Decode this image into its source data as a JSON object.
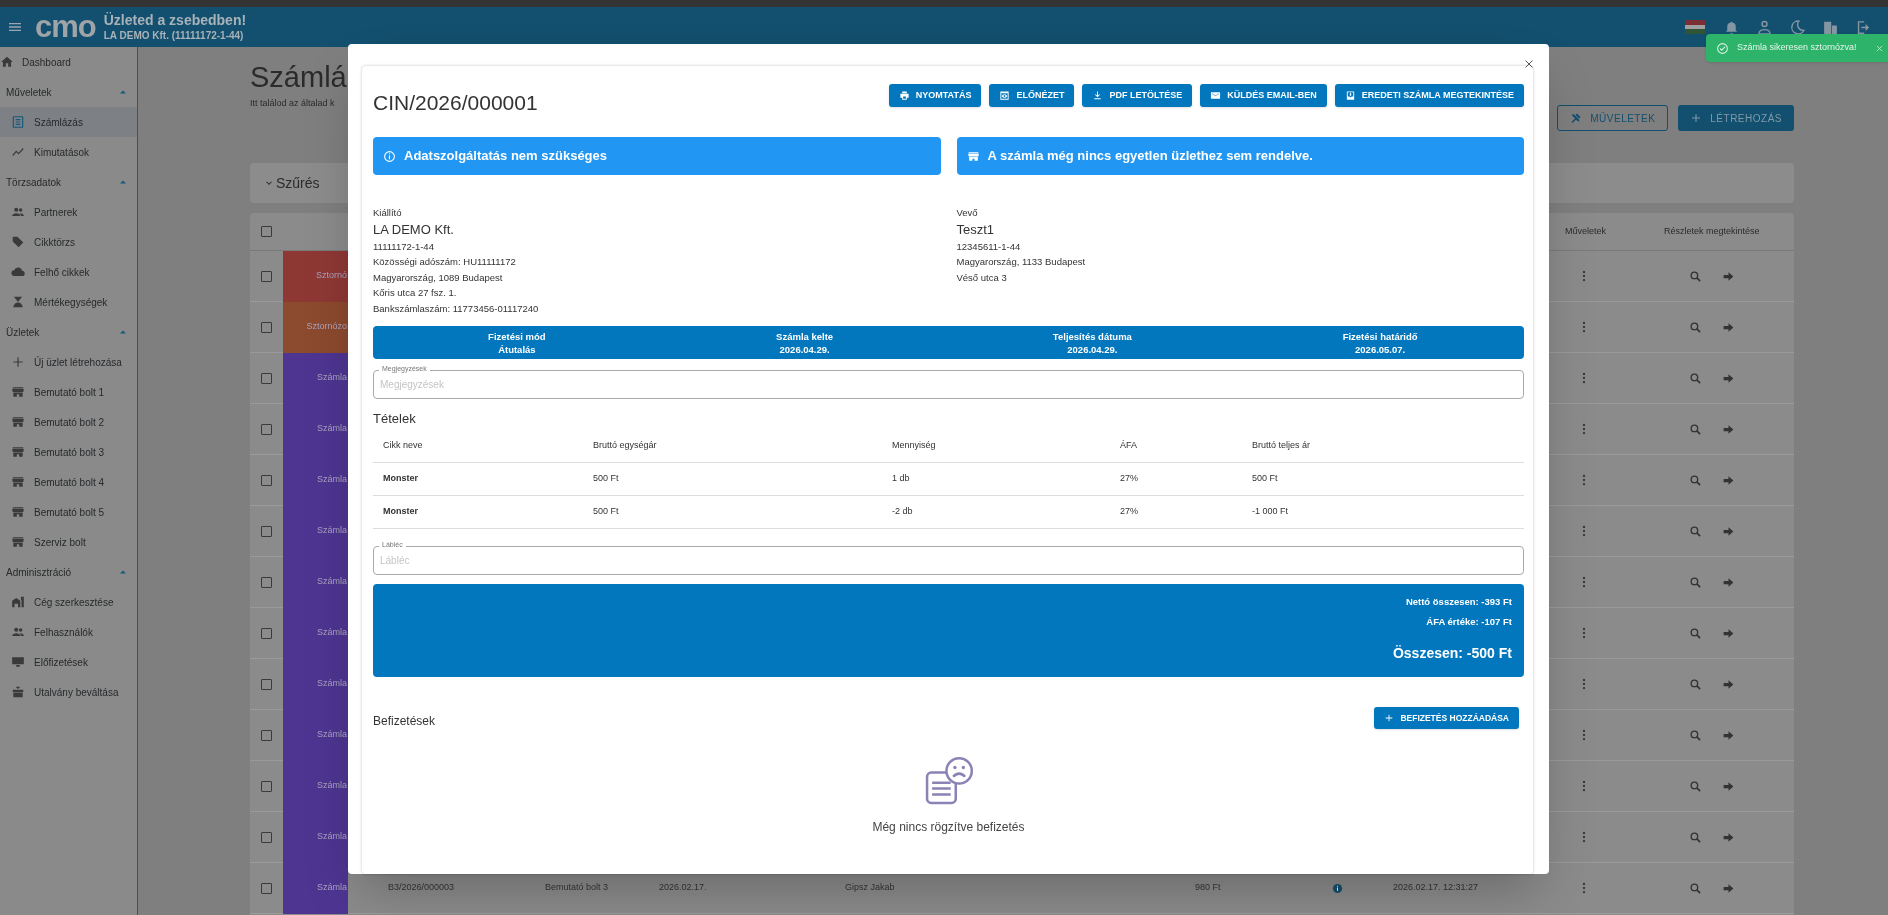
{
  "header": {
    "logo": "cmo",
    "title": "Üzleted a zsebedben!",
    "subtitle": "LA DEMO Kft. (11111172-1-44)"
  },
  "toast": {
    "message": "Számla sikeresen sztornózva!"
  },
  "sidebar": {
    "items": [
      {
        "kind": "link",
        "label": "Dashboard",
        "selected": false
      },
      {
        "kind": "section",
        "label": "Műveletek",
        "expanded": true
      },
      {
        "kind": "item",
        "label": "Számlázás",
        "selected": true
      },
      {
        "kind": "item",
        "label": "Kimutatások",
        "selected": false
      },
      {
        "kind": "section",
        "label": "Törzsadatok",
        "expanded": true
      },
      {
        "kind": "item",
        "label": "Partnerek",
        "selected": false
      },
      {
        "kind": "item",
        "label": "Cikktörzs",
        "selected": false
      },
      {
        "kind": "item",
        "label": "Felhő cikkek",
        "selected": false
      },
      {
        "kind": "item",
        "label": "Mértékegységek",
        "selected": false
      },
      {
        "kind": "section",
        "label": "Üzletek",
        "expanded": true
      },
      {
        "kind": "item",
        "label": "Új üzlet létrehozása",
        "selected": false
      },
      {
        "kind": "item",
        "label": "Bemutató bolt 1",
        "selected": false
      },
      {
        "kind": "item",
        "label": "Bemutató bolt 2",
        "selected": false
      },
      {
        "kind": "item",
        "label": "Bemutató bolt 3",
        "selected": false
      },
      {
        "kind": "item",
        "label": "Bemutató bolt 4",
        "selected": false
      },
      {
        "kind": "item",
        "label": "Bemutató bolt 5",
        "selected": false
      },
      {
        "kind": "item",
        "label": "Szerviz bolt",
        "selected": false
      },
      {
        "kind": "section",
        "label": "Adminisztráció",
        "expanded": true
      },
      {
        "kind": "item",
        "label": "Cég szerkesztése",
        "selected": false
      },
      {
        "kind": "item",
        "label": "Felhasználók",
        "selected": false
      },
      {
        "kind": "item",
        "label": "Előfizetések",
        "selected": false
      },
      {
        "kind": "item",
        "label": "Utalvány beváltása",
        "selected": false
      }
    ]
  },
  "page": {
    "title": "Számlá",
    "subtitle": "Itt találod az általad k",
    "buttons": [
      "MŰVELETEK",
      "LÉTREHOZÁS"
    ],
    "filter": "Szűrés"
  },
  "table": {
    "select_all_checked": false,
    "columns": [
      "Műveletek",
      "Részletek megtekintése"
    ],
    "rows": [
      {
        "status": "Sztornó",
        "color": "#8e3834",
        "checked": false
      },
      {
        "status": "Sztornózo",
        "color": "#8c4a2e",
        "checked": false
      },
      {
        "status": "Számla",
        "color": "#4e3592",
        "checked": false
      },
      {
        "status": "Számla",
        "color": "#4e3592",
        "checked": false
      },
      {
        "status": "Számla",
        "color": "#4e3592",
        "checked": false
      },
      {
        "status": "Számla",
        "color": "#4e3592",
        "checked": false
      },
      {
        "status": "Számla",
        "color": "#4e3592",
        "checked": false
      },
      {
        "status": "Számla",
        "color": "#4e3592",
        "checked": false
      },
      {
        "status": "Számla",
        "color": "#4e3592",
        "checked": false
      },
      {
        "status": "Számla",
        "color": "#4e3592",
        "checked": false
      },
      {
        "status": "Számla",
        "color": "#4e3592",
        "checked": false
      },
      {
        "status": "Számla",
        "color": "#4e3592",
        "checked": false
      },
      {
        "status": "Számla",
        "color": "#4e3592",
        "checked": false,
        "cells": [
          "B3/2026/000003",
          "Bemutató bolt 3",
          "2026.02.17.",
          "Gipsz Jakab",
          "980 Ft",
          "2026.02.17. 12:31:27"
        ]
      }
    ]
  },
  "modal": {
    "title": "CIN/2026/000001",
    "actions": [
      "NYOMTATÁS",
      "ELŐNÉZET",
      "PDF LETÖLTÉSE",
      "KÜLDÉS EMAIL-BEN",
      "EREDETI SZÁMLA MEGTEKINTÉSE"
    ],
    "banners": [
      "Adatszolgáltatás nem szükséges",
      "A számla még nincs egyetlen üzlethez sem rendelve."
    ],
    "issuer": {
      "heading": "Kiállító",
      "name": "LA DEMO Kft.",
      "lines": [
        "11111172-1-44",
        "Közösségi adószám: HU11111172",
        "Magyarország, 1089 Budapest",
        "Kőris utca 27 fsz. 1.",
        "Bankszámlaszám: 11773456-01117240"
      ]
    },
    "buyer": {
      "heading": "Vevő",
      "name": "Teszt1",
      "lines": [
        "12345611-1-44",
        "Magyarország, 1133 Budapest",
        "Véső utca 3"
      ]
    },
    "info_bar": [
      {
        "label": "Fizetési mód",
        "value": "Átutalás"
      },
      {
        "label": "Számla kelte",
        "value": "2026.04.29."
      },
      {
        "label": "Teljesítés dátuma",
        "value": "2026.04.29."
      },
      {
        "label": "Fizetési határidő",
        "value": "2026.05.07."
      }
    ],
    "notes": {
      "label": "Megjegyzések",
      "placeholder": "Megjegyzések"
    },
    "items": {
      "title": "Tételek",
      "columns": [
        "Cikk neve",
        "Bruttó egységár",
        "Mennyiség",
        "ÁFA",
        "Bruttó teljes ár"
      ],
      "rows": [
        [
          "Monster",
          "500 Ft",
          "1 db",
          "27%",
          "500 Ft"
        ],
        [
          "Monster",
          "500 Ft",
          "-2 db",
          "27%",
          "-1 000 Ft"
        ]
      ]
    },
    "footer": {
      "label": "Lábléc",
      "placeholder": "Lábléc"
    },
    "totals": {
      "net": "Nettó összesen: -393 Ft",
      "vat": "ÁFA értéke: -107 Ft",
      "total": "Összesen: -500 Ft"
    },
    "payments": {
      "title": "Befizetések",
      "add_button": "BEFIZETÉS HOZZÁADÁSA",
      "empty_text": "Még nincs rögzítve befizetés"
    }
  }
}
